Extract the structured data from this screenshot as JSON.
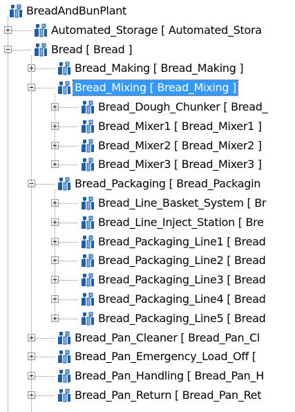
{
  "tree": {
    "root": {
      "label": "BreadAndBunPlant"
    },
    "nodes": [
      {
        "id": "automated-storage",
        "label": "Automated_Storage [ Automated_Stora"
      },
      {
        "id": "bread",
        "label": "Bread [ Bread ]"
      },
      {
        "id": "bread-making",
        "label": "Bread_Making [ Bread_Making ]"
      },
      {
        "id": "bread-mixing",
        "label": "Bread_Mixing [ Bread_Mixing ]"
      },
      {
        "id": "bread-dough-chunker",
        "label": "Bread_Dough_Chunker [ Bread_"
      },
      {
        "id": "bread-mixer1",
        "label": "Bread_Mixer1 [ Bread_Mixer1 ]"
      },
      {
        "id": "bread-mixer2",
        "label": "Bread_Mixer2 [ Bread_Mixer2 ]"
      },
      {
        "id": "bread-mixer3",
        "label": "Bread_Mixer3 [ Bread_Mixer3 ]"
      },
      {
        "id": "bread-packaging",
        "label": "Bread_Packaging [ Bread_Packagin"
      },
      {
        "id": "bread-line-basket-system",
        "label": "Bread_Line_Basket_System [ Br"
      },
      {
        "id": "bread-line-inject-station",
        "label": "Bread_Line_Inject_Station [ Bre"
      },
      {
        "id": "bread-packaging-line1",
        "label": "Bread_Packaging_Line1 [ Bread"
      },
      {
        "id": "bread-packaging-line2",
        "label": "Bread_Packaging_Line2 [ Bread"
      },
      {
        "id": "bread-packaging-line3",
        "label": "Bread_Packaging_Line3 [ Bread"
      },
      {
        "id": "bread-packaging-line4",
        "label": "Bread_Packaging_Line4 [ Bread"
      },
      {
        "id": "bread-packaging-line5",
        "label": "Bread_Packaging_Line5 [ Bread"
      },
      {
        "id": "bread-pan-cleaner",
        "label": "Bread_Pan_Cleaner [ Bread_Pan_Cl"
      },
      {
        "id": "bread-pan-emergency-load-off",
        "label": "Bread_Pan_Emergency_Load_Off ["
      },
      {
        "id": "bread-pan-handling",
        "label": "Bread_Pan_Handling [ Bread_Pan_H"
      },
      {
        "id": "bread-pan-return",
        "label": "Bread_Pan_Return [ Bread_Pan_Ret"
      }
    ],
    "selected": "bread-mixing",
    "colors": {
      "selection": "#3399ff",
      "selection_text": "#ffffff",
      "icon_body": "#1f5fa8",
      "icon_accent": "#7fb3e6"
    },
    "icon": "object-template-icon"
  }
}
